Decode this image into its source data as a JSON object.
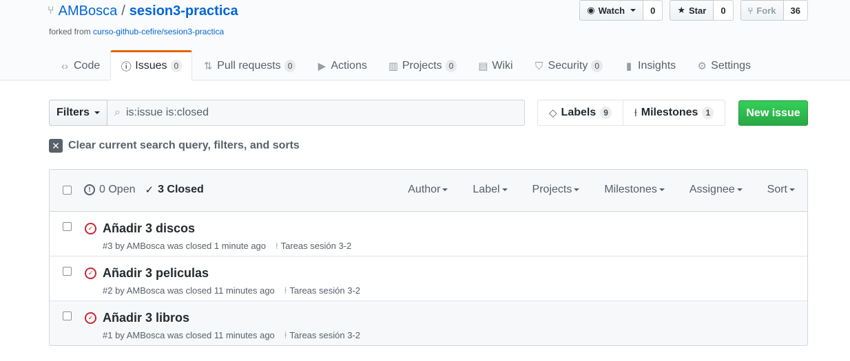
{
  "repo": {
    "owner": "AMBosca",
    "separator": "/",
    "name": "sesion3-practica",
    "forked_prefix": "forked from",
    "forked_link": "curso-github-cefire/sesion3-practica"
  },
  "actions": {
    "watch": {
      "label": "Watch",
      "count": "0"
    },
    "star": {
      "label": "Star",
      "count": "0"
    },
    "fork": {
      "label": "Fork",
      "count": "36"
    }
  },
  "tabs": [
    {
      "label": "Code",
      "icon": "code-icon",
      "glyph": "<>"
    },
    {
      "label": "Issues",
      "icon": "issue-opened-icon",
      "glyph": "ⓘ",
      "count": "0"
    },
    {
      "label": "Pull requests",
      "icon": "git-pull-request-icon",
      "glyph": "⇅",
      "count": "0"
    },
    {
      "label": "Actions",
      "icon": "play-icon",
      "glyph": "▶"
    },
    {
      "label": "Projects",
      "icon": "project-icon",
      "glyph": "▥",
      "count": "0"
    },
    {
      "label": "Wiki",
      "icon": "book-icon",
      "glyph": "▤"
    },
    {
      "label": "Security",
      "icon": "shield-icon",
      "glyph": "⛉",
      "count": "0"
    },
    {
      "label": "Insights",
      "icon": "graph-icon",
      "glyph": "▮"
    },
    {
      "label": "Settings",
      "icon": "gear-icon",
      "glyph": "⚙"
    }
  ],
  "subnav": {
    "filters_label": "Filters",
    "search_value": "is:issue is:closed",
    "labels": {
      "label": "Labels",
      "count": "9"
    },
    "milestones": {
      "label": "Milestones",
      "count": "1"
    },
    "new_issue": "New issue"
  },
  "clear_query": "Clear current search query, filters, and sorts",
  "issues_header": {
    "open": "0 Open",
    "closed": "3 Closed",
    "menus": [
      "Author",
      "Label",
      "Projects",
      "Milestones",
      "Assignee",
      "Sort"
    ]
  },
  "issues": [
    {
      "title": "Añadir 3 discos",
      "meta": "#3 by AMBosca was closed 1 minute ago",
      "milestone": "Tareas sesión 3-2"
    },
    {
      "title": "Añadir 3 peliculas",
      "meta": "#2 by AMBosca was closed 11 minutes ago",
      "milestone": "Tareas sesión 3-2"
    },
    {
      "title": "Añadir 3 libros",
      "meta": "#1 by AMBosca was closed 11 minutes ago",
      "milestone": "Tareas sesión 3-2"
    }
  ],
  "colors": {
    "link": "#0366d6",
    "selected_tab_accent": "#e36209",
    "new_issue_green": "#28a745",
    "closed_icon_red": "#cb2431"
  }
}
